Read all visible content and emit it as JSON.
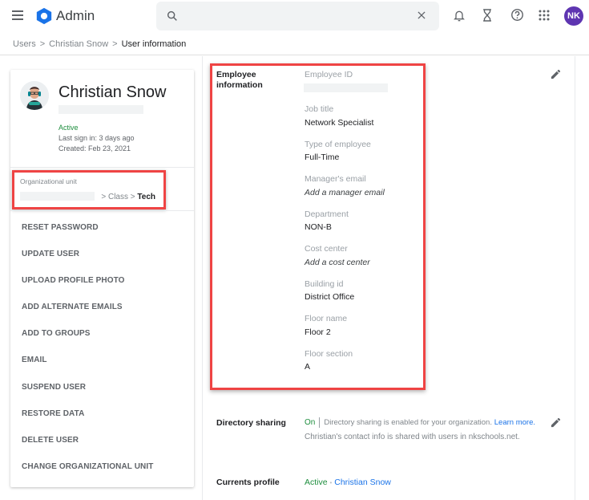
{
  "app": {
    "title": "Admin",
    "search_placeholder": "",
    "avatar_initials": "NK",
    "icons": [
      "menu-icon",
      "admin-logo-icon",
      "search-icon",
      "clear-icon",
      "notifications-bell-icon",
      "hourglass-tasks-icon",
      "help-icon",
      "apps-grid-icon"
    ]
  },
  "breadcrumb": {
    "items": [
      "Users",
      "Christian Snow",
      "User information"
    ],
    "separator": ">"
  },
  "colors": {
    "brand_blue": "#1a73e8",
    "active_green": "#1e8e3e",
    "avatar_purple": "#5e35b1",
    "highlight_red": "#ef4444"
  },
  "user_card": {
    "name": "Christian Snow",
    "status": "Active",
    "last_sign_in": "Last sign in: 3 days ago",
    "created": "Created: Feb 23, 2021",
    "org_unit": {
      "label": "Organizational unit",
      "path_middle": "Class",
      "path_last": "Tech",
      "separator": ">"
    },
    "actions": [
      "RESET PASSWORD",
      "UPDATE USER",
      "UPLOAD PROFILE PHOTO",
      "ADD ALTERNATE EMAILS",
      "ADD TO GROUPS",
      "EMAIL",
      "SUSPEND USER",
      "RESTORE DATA",
      "DELETE USER",
      "CHANGE ORGANIZATIONAL UNIT"
    ]
  },
  "employee_info": {
    "section_title_line1": "Employee",
    "section_title_line2": "information",
    "fields": [
      {
        "label": "Employee ID",
        "value": ""
      },
      {
        "label": "Job title",
        "value": "Network Specialist"
      },
      {
        "label": "Type of employee",
        "value": "Full-Time"
      },
      {
        "label": "Manager's email",
        "value": "Add a manager email"
      },
      {
        "label": "Department",
        "value": "NON-B"
      },
      {
        "label": "Cost center",
        "value": "Add a cost center"
      },
      {
        "label": "Building id",
        "value": "District Office"
      },
      {
        "label": "Floor name",
        "value": "Floor 2"
      },
      {
        "label": "Floor section",
        "value": "A"
      }
    ]
  },
  "directory_sharing": {
    "title": "Directory sharing",
    "status": "On",
    "description": "Directory sharing is enabled for your organization.",
    "learn_more": "Learn more.",
    "detail": "Christian's contact info is shared with users in nkschools.net."
  },
  "currents_profile": {
    "title": "Currents profile",
    "status": "Active",
    "bullet": "•",
    "profile_name": "Christian Snow"
  }
}
